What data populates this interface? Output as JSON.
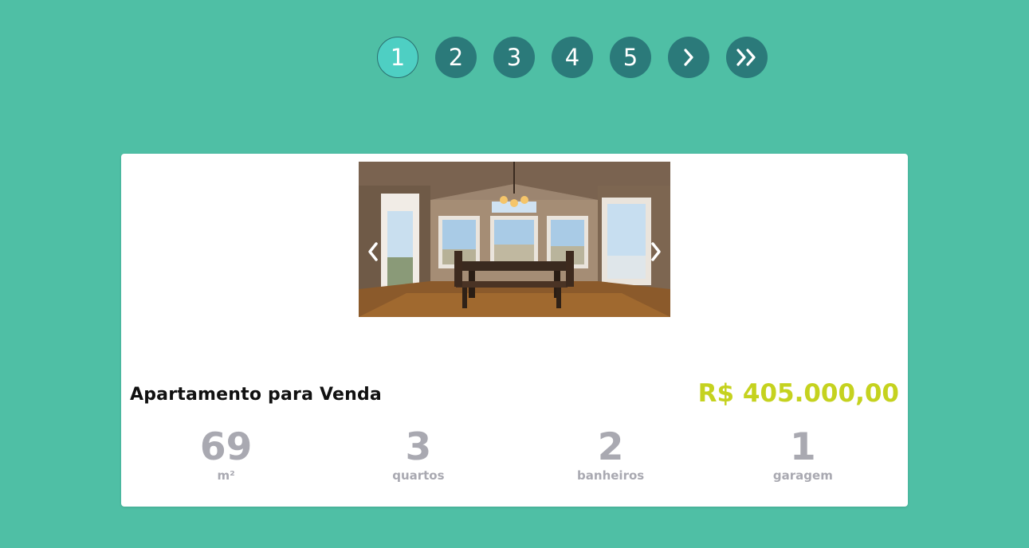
{
  "pagination": {
    "pages": [
      "1",
      "2",
      "3",
      "4",
      "5"
    ],
    "active_page": "1",
    "next_icon": "chevron-right-icon",
    "last_icon": "double-chevron-right-icon"
  },
  "listing": {
    "title": "Apartamento para Venda",
    "price": "R$ 405.000,00",
    "photo_alt": "dining-room-photo",
    "features": [
      {
        "value": "69",
        "label": "m²"
      },
      {
        "value": "3",
        "label": "quartos"
      },
      {
        "value": "2",
        "label": "banheiros"
      },
      {
        "value": "1",
        "label": "garagem"
      }
    ]
  },
  "colors": {
    "background": "#4fbfa5",
    "page_button": "#2b7a7a",
    "page_button_active": "#4ecfc3",
    "price": "#c5d21f",
    "feature_text": "#a9a9b1"
  }
}
